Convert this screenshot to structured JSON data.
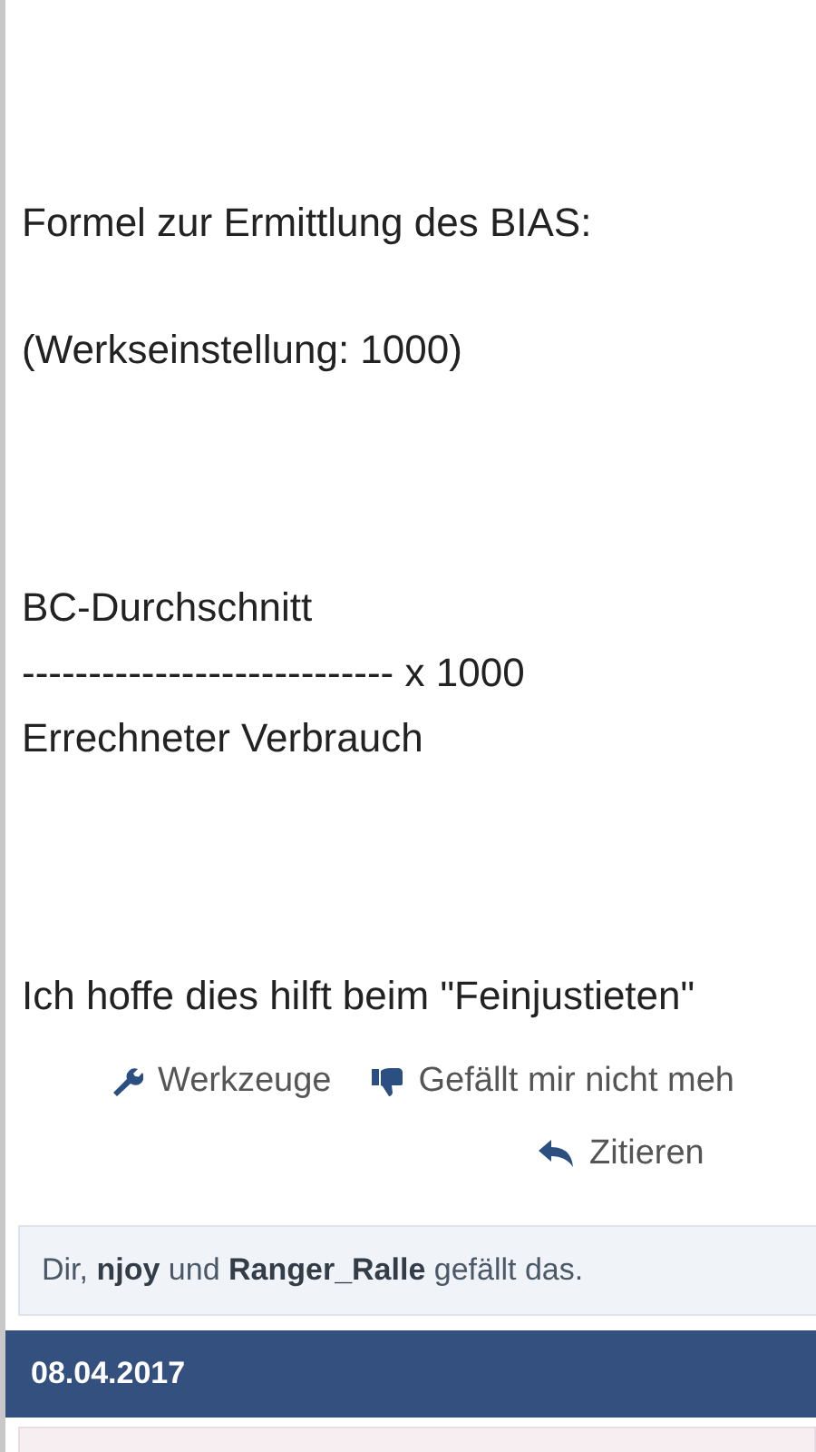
{
  "post": {
    "paragraphs": [
      [
        "Formel zur Ermittlung des BIAS:"
      ],
      [
        "(Werkseinstellung: 1000)"
      ],
      [
        "BC-Durchschnitt",
        "---------------------------- x 1000",
        "Errechneter Verbrauch"
      ],
      [
        "Ich hoffe dies hilft beim \"Feinjustieten\""
      ]
    ]
  },
  "actions": [
    {
      "kind": "tools",
      "label": "Werkzeuge"
    },
    {
      "kind": "dislike",
      "label": "Gefällt mir nicht meh"
    },
    {
      "kind": "quote",
      "label": "Zitieren"
    }
  ],
  "likes": "Dir, **njoy** und **Ranger_Ralle** gefällt das.",
  "next_post": {
    "date": "08.04.2017"
  }
}
